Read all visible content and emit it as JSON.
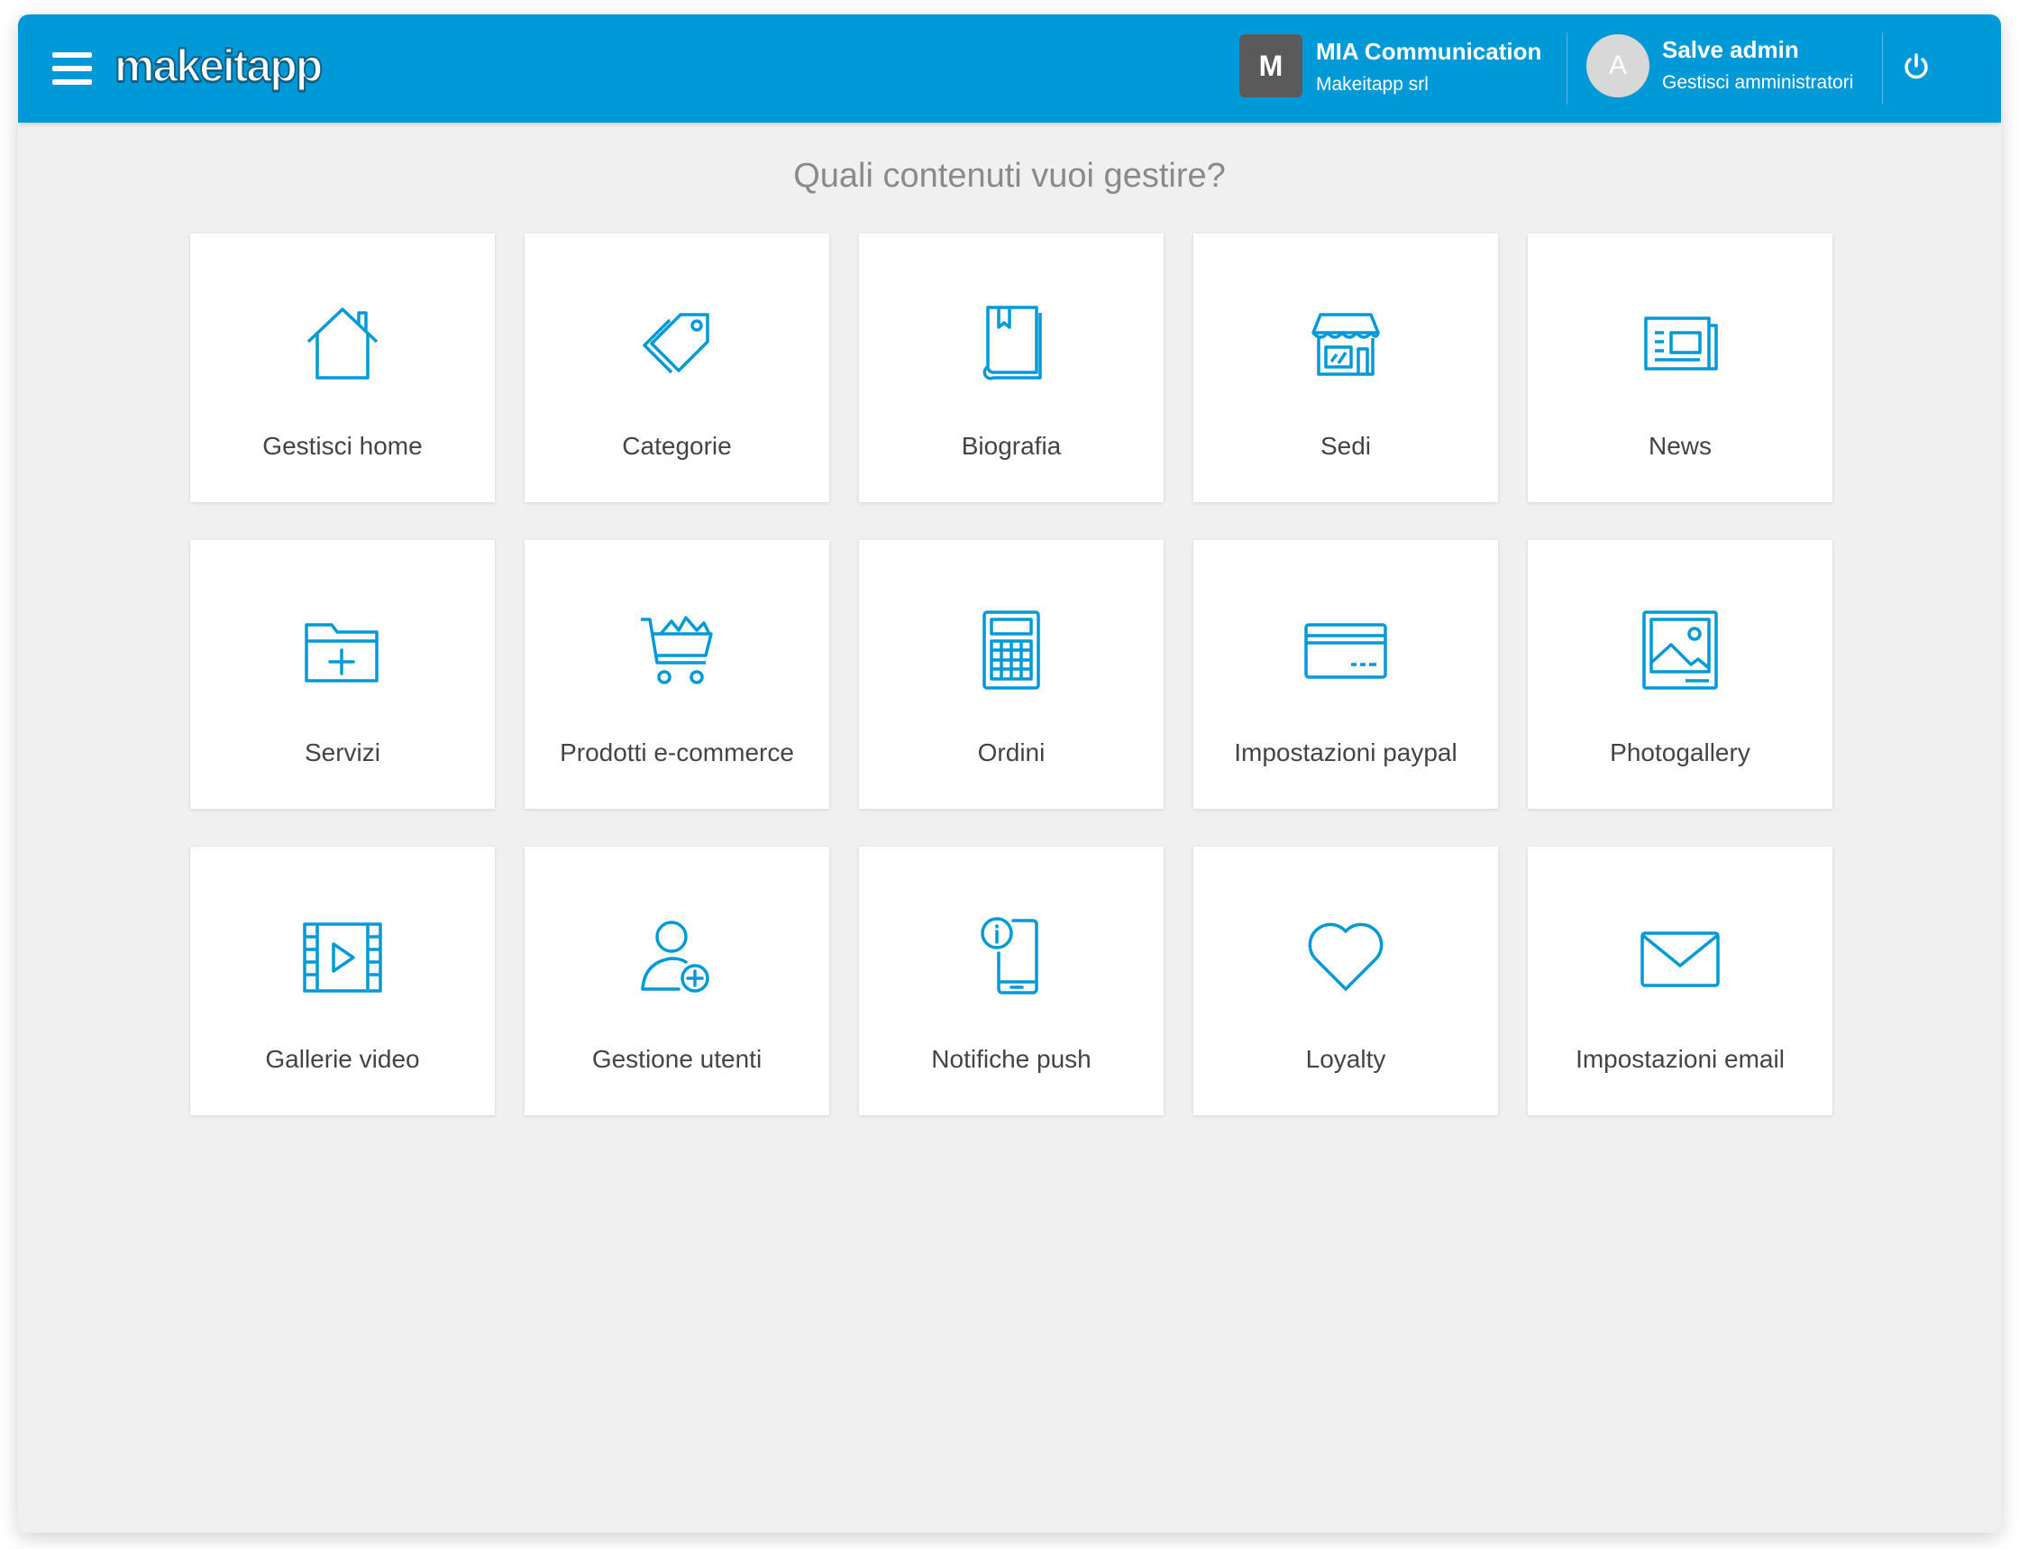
{
  "header": {
    "logo_text": "makeitapp",
    "org": {
      "initial": "M",
      "name": "MIA Communication",
      "subtitle": "Makeitapp srl"
    },
    "user": {
      "initial": "A",
      "greeting": "Salve admin",
      "link": "Gestisci amministratori"
    },
    "brand_color": "#0099d8"
  },
  "main": {
    "heading": "Quali contenuti vuoi gestire?",
    "tiles": [
      {
        "label": "Gestisci home",
        "icon": "home-icon"
      },
      {
        "label": "Categorie",
        "icon": "tags-icon"
      },
      {
        "label": "Biografia",
        "icon": "book-icon"
      },
      {
        "label": "Sedi",
        "icon": "store-icon"
      },
      {
        "label": "News",
        "icon": "newspaper-icon"
      },
      {
        "label": "Servizi",
        "icon": "folder-plus-icon"
      },
      {
        "label": "Prodotti e-commerce",
        "icon": "cart-icon"
      },
      {
        "label": "Ordini",
        "icon": "calculator-icon"
      },
      {
        "label": "Impostazioni paypal",
        "icon": "credit-card-icon"
      },
      {
        "label": "Photogallery",
        "icon": "picture-icon"
      },
      {
        "label": "Gallerie video",
        "icon": "film-icon"
      },
      {
        "label": "Gestione utenti",
        "icon": "add-user-icon"
      },
      {
        "label": "Notifiche push",
        "icon": "phone-info-icon"
      },
      {
        "label": "Loyalty",
        "icon": "heart-icon"
      },
      {
        "label": "Impostazioni email",
        "icon": "envelope-icon"
      }
    ]
  }
}
